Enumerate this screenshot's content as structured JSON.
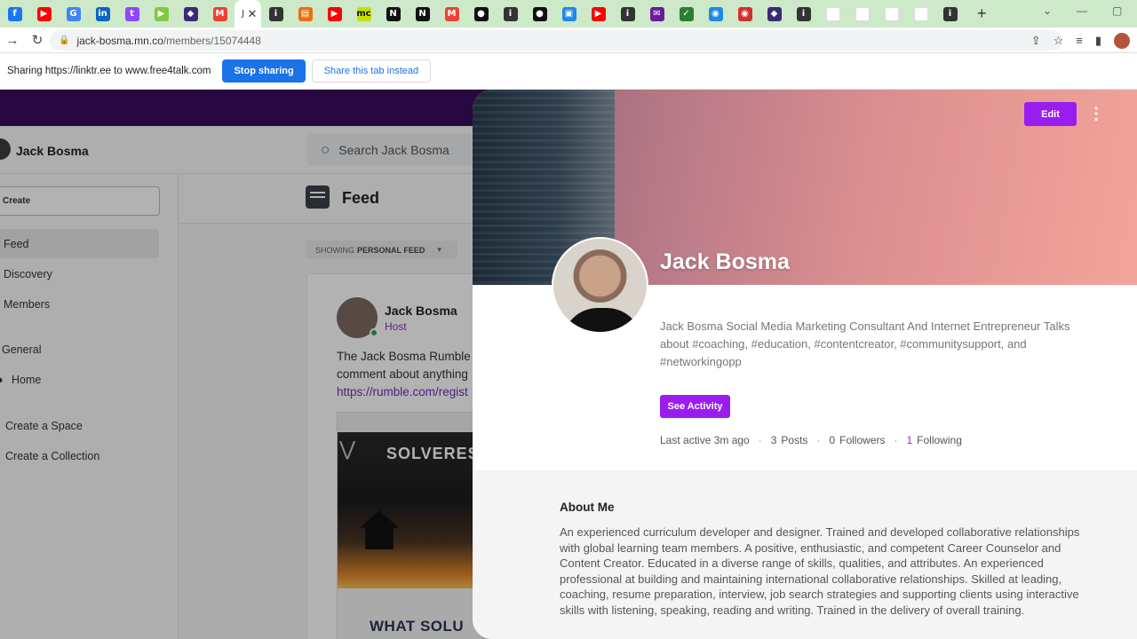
{
  "browser": {
    "tabs": [
      {
        "icon": "facebook-icon",
        "color": "#1877f2",
        "glyph": "f"
      },
      {
        "icon": "youtube-icon",
        "color": "#ff0000",
        "glyph": "▶"
      },
      {
        "icon": "google-icon",
        "color": "#4285f4",
        "glyph": "G"
      },
      {
        "icon": "linkedin-icon",
        "color": "#0a66c2",
        "glyph": "in"
      },
      {
        "icon": "twitch-icon",
        "color": "#9146ff",
        "glyph": "t"
      },
      {
        "icon": "rumble-icon",
        "color": "#85c742",
        "glyph": "▶"
      },
      {
        "icon": "site-icon",
        "color": "#3a2b7a",
        "glyph": "◆"
      },
      {
        "icon": "gmail-icon",
        "color": "#ea4335",
        "glyph": "M"
      },
      {
        "icon": "active-tab",
        "color": "#ffffff",
        "glyph": "J",
        "active": true
      },
      {
        "icon": "info-icon",
        "color": "#333333",
        "glyph": "i"
      },
      {
        "icon": "bookmark-icon",
        "color": "#e8710a",
        "glyph": "▤"
      },
      {
        "icon": "youtube-icon",
        "color": "#ff0000",
        "glyph": "▶"
      },
      {
        "icon": "mc-icon",
        "color": "#c6e000",
        "glyph": "mc"
      },
      {
        "icon": "notion-icon",
        "color": "#111111",
        "glyph": "N"
      },
      {
        "icon": "notion-icon",
        "color": "#111111",
        "glyph": "N"
      },
      {
        "icon": "gmail-icon",
        "color": "#ea4335",
        "glyph": "M"
      },
      {
        "icon": "circle-icon",
        "color": "#111111",
        "glyph": "●"
      },
      {
        "icon": "info-icon",
        "color": "#333333",
        "glyph": "i"
      },
      {
        "icon": "circle-icon",
        "color": "#111111",
        "glyph": "●"
      },
      {
        "icon": "window-icon",
        "color": "#1e88e5",
        "glyph": "▣"
      },
      {
        "icon": "youtube-icon",
        "color": "#ff0000",
        "glyph": "▶"
      },
      {
        "icon": "info-icon",
        "color": "#333333",
        "glyph": "i"
      },
      {
        "icon": "mail-icon",
        "color": "#6a1b9a",
        "glyph": "✉"
      },
      {
        "icon": "feather-icon",
        "color": "#2e7d32",
        "glyph": "✓"
      },
      {
        "icon": "globe-icon",
        "color": "#1e88e5",
        "glyph": "◉"
      },
      {
        "icon": "record-icon",
        "color": "#d32f2f",
        "glyph": "◉"
      },
      {
        "icon": "site-icon",
        "color": "#3a2b7a",
        "glyph": "◆"
      },
      {
        "icon": "info-icon",
        "color": "#333333",
        "glyph": "i"
      },
      {
        "icon": "blank-icon",
        "color": "#ffffff",
        "glyph": ""
      },
      {
        "icon": "blank-icon",
        "color": "#ffffff",
        "glyph": ""
      },
      {
        "icon": "blank-icon",
        "color": "#ffffff",
        "glyph": ""
      },
      {
        "icon": "blank-icon",
        "color": "#ffffff",
        "glyph": ""
      },
      {
        "icon": "info-icon",
        "color": "#333333",
        "glyph": "i"
      }
    ],
    "url_host": "jack-bosma.mn.co",
    "url_path": "/members/15074448"
  },
  "sharing": {
    "message": "Sharing https://linktr.ee to www.free4talk.com",
    "stop_label": "Stop sharing",
    "share_label": "Share this tab instead"
  },
  "site": {
    "name": "Jack Bosma",
    "search_placeholder": "Search Jack Bosma",
    "create_label": "Create",
    "nav": {
      "feed": "Feed",
      "discovery": "Discovery",
      "members": "Members",
      "general": "General",
      "home": "Home",
      "create_space": "Create a Space",
      "create_collection": "Create a Collection"
    },
    "feed_title": "Feed",
    "showing_prefix": "SHOWING",
    "showing_value": "PERSONAL FEED",
    "post": {
      "author": "Jack Bosma",
      "role": "Host",
      "line1": "The Jack Bosma Rumble",
      "line2": "comment about anything",
      "link": "https://rumble.com/regist",
      "image_brand": "SOLVERES",
      "image_caption": "WHAT SOLU"
    }
  },
  "profile": {
    "edit_label": "Edit",
    "name": "Jack Bosma",
    "bio": "Jack Bosma Social Media Marketing Consultant And Internet Entrepreneur Talks about #coaching, #education, #contentcreator, #communitysupport, and #networkingopp",
    "see_activity_label": "See Activity",
    "last_active": "Last active 3m ago",
    "posts_count": "3",
    "posts_label": "Posts",
    "followers_count": "0",
    "followers_label": "Followers",
    "following_count": "1",
    "following_label": "Following",
    "about_title": "About Me",
    "about_text": "An experienced curriculum developer and designer. Trained and developed collaborative relationships with global learning team members. A positive, enthusiastic, and competent Career Counselor and Content Creator. Educated in a diverse range of skills, qualities, and attributes. An experienced professional at building and maintaining international collaborative relationships. Skilled at leading, coaching, resume preparation, interview, job search strategies and supporting clients using interactive skills with listening, speaking, reading and writing. Trained in the delivery of overall training."
  }
}
